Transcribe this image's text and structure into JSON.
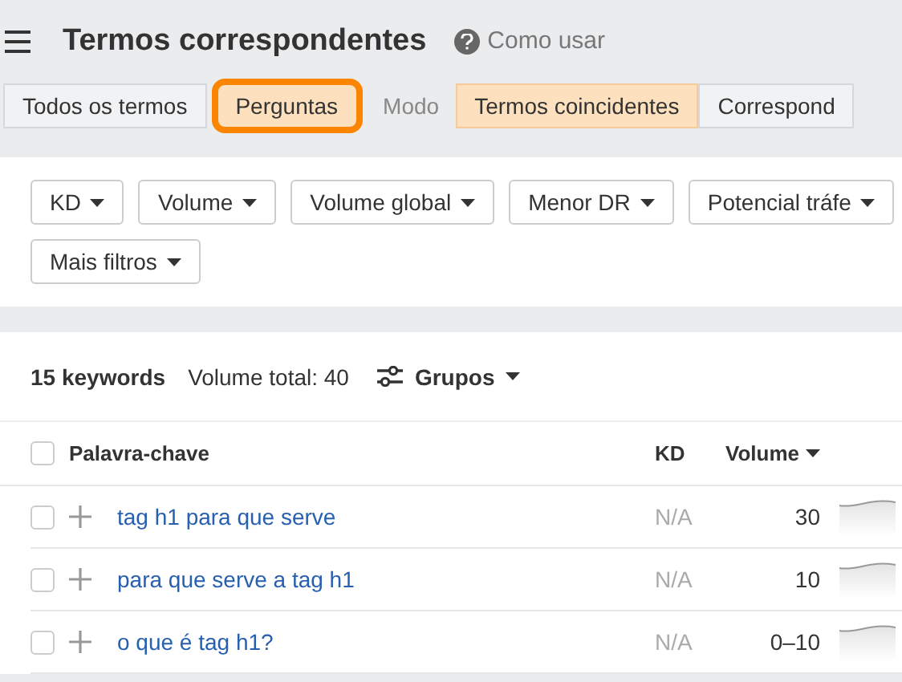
{
  "header": {
    "title": "Termos correspondentes",
    "help_link": "Como usar"
  },
  "tabs": [
    {
      "label": "Todos os termos",
      "selected": false,
      "highlighted": false
    },
    {
      "label": "Perguntas",
      "selected": true,
      "highlighted": true
    }
  ],
  "mode": {
    "label": "Modo",
    "options": [
      {
        "label": "Termos coincidentes",
        "selected": true
      },
      {
        "label": "Correspond",
        "selected": false
      }
    ]
  },
  "filters": [
    "KD",
    "Volume",
    "Volume global",
    "Menor DR",
    "Potencial tráfe",
    "Mais filtros"
  ],
  "summary": {
    "count": "15 keywords",
    "total": "Volume total: 40",
    "groups": "Grupos"
  },
  "table": {
    "columns": [
      "Palavra-chave",
      "KD",
      "Volume"
    ],
    "all_checked": false,
    "rows": [
      {
        "keyword": "tag h1 para que serve",
        "kd": "N/A",
        "volume": "30",
        "checked": false
      },
      {
        "keyword": "para que serve a tag h1",
        "kd": "N/A",
        "volume": "10",
        "checked": false
      },
      {
        "keyword": "o que é tag h1?",
        "kd": "N/A",
        "volume": "0–10",
        "checked": false
      }
    ]
  }
}
